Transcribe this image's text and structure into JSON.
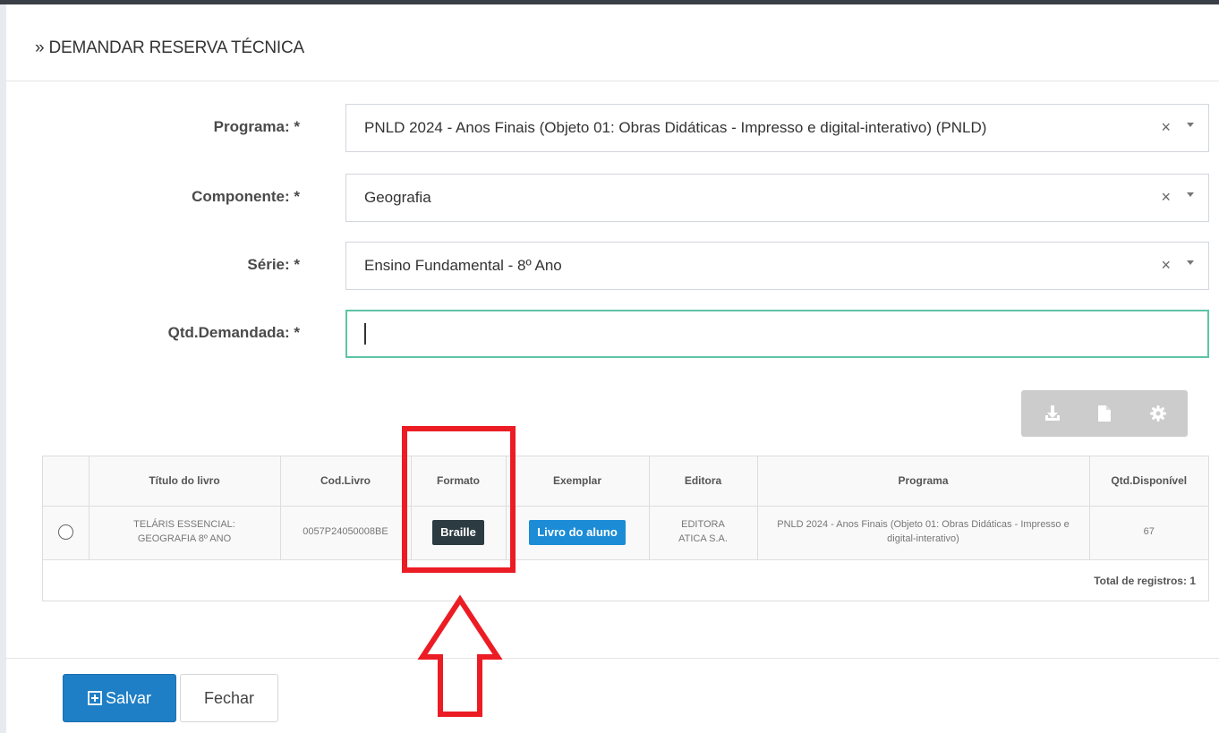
{
  "header": {
    "title": "» DEMANDAR RESERVA TÉCNICA"
  },
  "form": {
    "programa": {
      "label": "Programa: *",
      "value": "PNLD 2024 - Anos Finais (Objeto 01: Obras Didáticas - Impresso e digital-interativo) (PNLD)"
    },
    "componente": {
      "label": "Componente: *",
      "value": "Geografia"
    },
    "serie": {
      "label": "Série: *",
      "value": "Ensino Fundamental - 8º Ano"
    },
    "qtd": {
      "label": "Qtd.Demandada: *",
      "value": ""
    }
  },
  "icons": {
    "clear": "×",
    "download": "download-icon",
    "document": "file-icon",
    "settings": "gear-icon"
  },
  "table": {
    "headers": [
      "",
      "Título do livro",
      "Cod.Livro",
      "Formato",
      "Exemplar",
      "Editora",
      "Programa",
      "Qtd.Disponível"
    ],
    "rows": [
      {
        "titulo": "TELÁRIS ESSENCIAL: GEOGRAFIA 8º ANO",
        "cod": "0057P24050008BE",
        "formato": "Braille",
        "exemplar": "Livro do aluno",
        "editora": "EDITORA ATICA S.A.",
        "programa": "PNLD 2024 - Anos Finais (Objeto 01: Obras Didáticas - Impresso e digital-interativo)",
        "qtd": "67"
      }
    ],
    "total": "Total de registros: 1"
  },
  "footer": {
    "save_label": "Salvar",
    "close_label": "Fechar"
  },
  "colors": {
    "primary": "#1f7fc6",
    "active_border": "#5dc4a6",
    "badge_dark": "#2c3b41",
    "badge_blue": "#1c8cd6",
    "annotation": "#ec1c24"
  }
}
